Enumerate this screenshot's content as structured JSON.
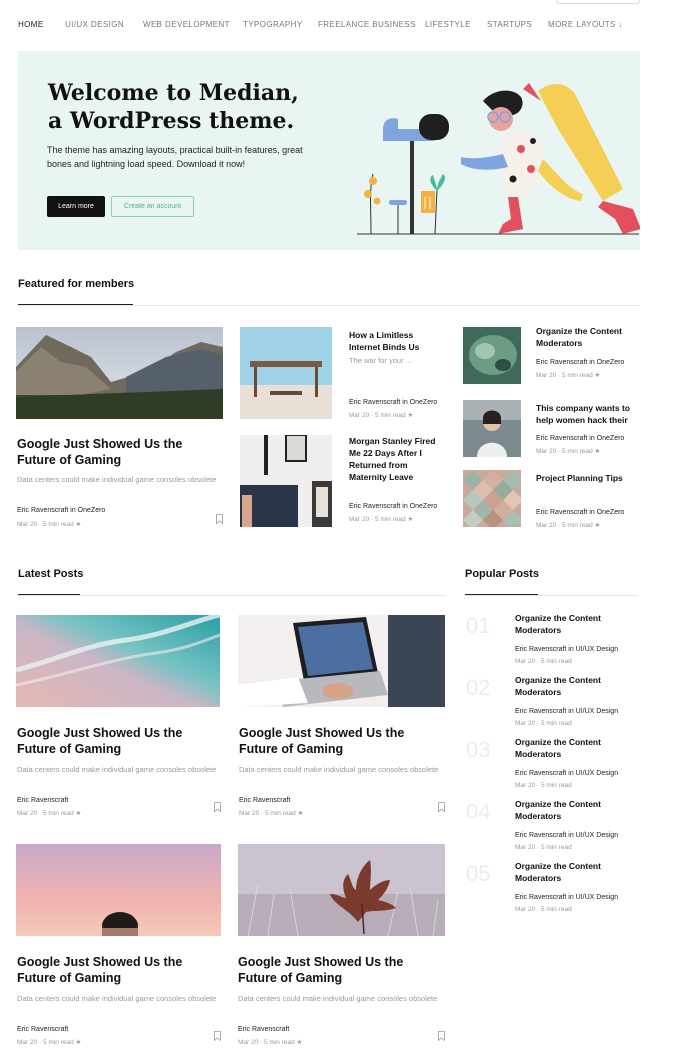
{
  "nav": {
    "items": [
      "HOME",
      "UI/UX DESIGN",
      "WEB DEVELOPMENT",
      "TYPOGRAPHY",
      "FREELANCE BUSINESS",
      "LIFESTYLE",
      "STARTUPS",
      "MORE LAYOUTS ↓"
    ],
    "active": "HOME"
  },
  "hero": {
    "title_line1": "Welcome to Median,",
    "title_line2": "a WordPress theme.",
    "text": "The theme has amazing layouts, practical built-in features, great bones and lightning load speed. Download it now!",
    "learn_more": "Learn more",
    "create_account": "Create an account"
  },
  "featured": {
    "heading": "Featured for members",
    "main": {
      "title": "Google Just Showed Us the Future of Gaming",
      "excerpt": "Data centers could make individual game consoles obsolete",
      "author": "Eric Ravenscraft in OneZero",
      "meta": "Mar 20 · 5 min read ★"
    },
    "middle": [
      {
        "title": "How a Limitless Internet Binds Us",
        "excerpt": "The war for your ...",
        "author": "Eric Ravenscraft in OneZero",
        "meta": "Mar 20 · 5 min read ★"
      },
      {
        "title": "Morgan Stanley Fired Me 22 Days After I Returned from Maternity Leave",
        "author": "Eric Ravenscraft in OneZero",
        "meta": "Mar 20 · 5 min read ★"
      }
    ],
    "right": [
      {
        "title": "Organize the Content Moderators",
        "author": "Eric Ravenscraft in OneZero",
        "meta": "Mar 20 · 5 min read ★"
      },
      {
        "title": "This company wants to help women hack their",
        "author": "Eric Ravenscraft in OneZero",
        "meta": "Mar 20 · 5 min read ★"
      },
      {
        "title": "Project Planning Tips",
        "author": "Eric Ravenscraft in OneZero",
        "meta": "Mar 20 · 5 min read ★"
      }
    ]
  },
  "latest": {
    "heading": "Latest Posts",
    "posts": [
      {
        "title": "Google Just Showed Us the Future of Gaming",
        "excerpt": "Data centers could make individual game consoles obsolete",
        "author": "Eric Ravenscraft",
        "meta": "Mar 20 · 5 min read ★"
      },
      {
        "title": "Google Just Showed Us the Future of Gaming",
        "excerpt": "Data centers could make individual game consoles obsolete",
        "author": "Eric Ravenscraft",
        "meta": "Mar 20 · 5 min read ★"
      },
      {
        "title": "Google Just Showed Us the Future of Gaming",
        "excerpt": "Data centers could make individual game consoles obsolete",
        "author": "Eric Ravenscraft",
        "meta": "Mar 20 · 5 min read ★"
      },
      {
        "title": "Google Just Showed Us the Future of Gaming",
        "excerpt": "Data centers could make individual game consoles obsolete",
        "author": "Eric Ravenscraft",
        "meta": "Mar 20 · 5 min read ★"
      }
    ]
  },
  "popular": {
    "heading": "Popular Posts",
    "items": [
      {
        "num": "01",
        "title": "Organize the Content Moderators",
        "author": "Eric Ravenscraft in UI/UX Design",
        "meta": "Mar 20 · 5 min read"
      },
      {
        "num": "02",
        "title": "Organize the Content Moderators",
        "author": "Eric Ravenscraft in UI/UX Design",
        "meta": "Mar 20 · 5 min read"
      },
      {
        "num": "03",
        "title": "Organize the Content Moderators",
        "author": "Eric Ravenscraft in UI/UX Design",
        "meta": "Mar 20 · 5 min read"
      },
      {
        "num": "04",
        "title": "Organize the Content Moderators",
        "author": "Eric Ravenscraft in UI/UX Design",
        "meta": "Mar 20 · 5 min read"
      },
      {
        "num": "05",
        "title": "Organize the Content Moderators",
        "author": "Eric Ravenscraft in UI/UX Design",
        "meta": "Mar 20 · 5 min read"
      }
    ]
  },
  "colors": {
    "hero_bg": "#e8f5f3",
    "accent_green": "#52b37a",
    "dark": "#111111"
  }
}
